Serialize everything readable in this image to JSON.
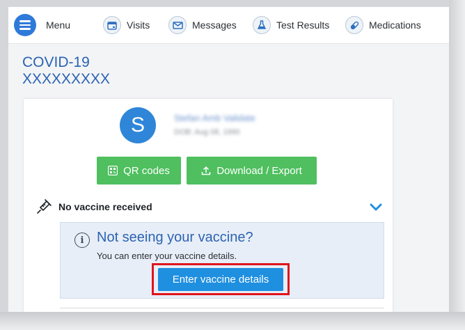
{
  "nav": {
    "items": [
      {
        "label": "Menu",
        "icon": "hamburger-menu-icon"
      },
      {
        "label": "Visits",
        "icon": "calendar-icon"
      },
      {
        "label": "Messages",
        "icon": "envelope-icon"
      },
      {
        "label": "Test Results",
        "icon": "flask-icon"
      },
      {
        "label": "Medications",
        "icon": "pills-icon"
      }
    ]
  },
  "page": {
    "title_line1": "COVID-19",
    "title_line2": "XXXXXXXXX"
  },
  "patient": {
    "avatar_letter": "S",
    "name_blurred": "Stefan Amb Validate",
    "dob_blurred": "DOB: Aug 08, 1990"
  },
  "actions": {
    "qr_label": "QR codes",
    "download_label": "Download / Export"
  },
  "vaccine": {
    "status": "No vaccine received",
    "notice_title": "Not seeing your vaccine?",
    "notice_text": "You can enter your vaccine details.",
    "enter_button": "Enter vaccine details"
  },
  "colors": {
    "brand_blue": "#2f7ad8",
    "green_button": "#4fbf5f",
    "highlight_red": "#e0141d"
  }
}
